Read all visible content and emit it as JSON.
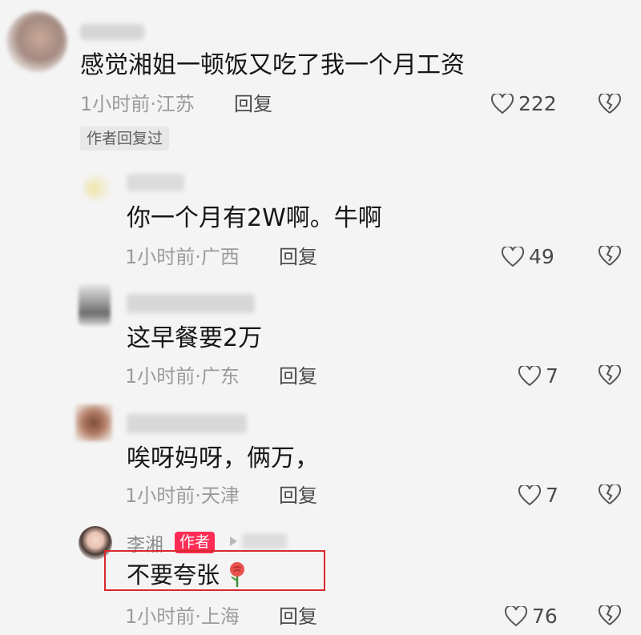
{
  "comments": [
    {
      "text": "感觉湘姐一顿饭又吃了我一个月工资",
      "meta": "1小时前·江苏",
      "reply_label": "回复",
      "likes": "222",
      "author_replied_tag": "作者回复过"
    },
    {
      "text": "你一个月有2W啊。牛啊",
      "meta": "1小时前·广西",
      "reply_label": "回复",
      "likes": "49"
    },
    {
      "text": "这早餐要2万",
      "meta": "1小时前·广东",
      "reply_label": "回复",
      "likes": "7"
    },
    {
      "text": "唉呀妈呀，俩万，",
      "meta": "1小时前·天津",
      "reply_label": "回复",
      "likes": "7"
    },
    {
      "username": "李湘",
      "author_badge": "作者",
      "text": "不要夸张",
      "meta": "1小时前·上海",
      "reply_label": "回复",
      "likes": "76"
    }
  ],
  "icons": {
    "like": "heart-outline-icon",
    "dislike": "broken-heart-icon",
    "emoji": "rose-emoji-icon"
  },
  "colors": {
    "author_badge": "#fe2c55",
    "highlight": "#d9272b"
  }
}
